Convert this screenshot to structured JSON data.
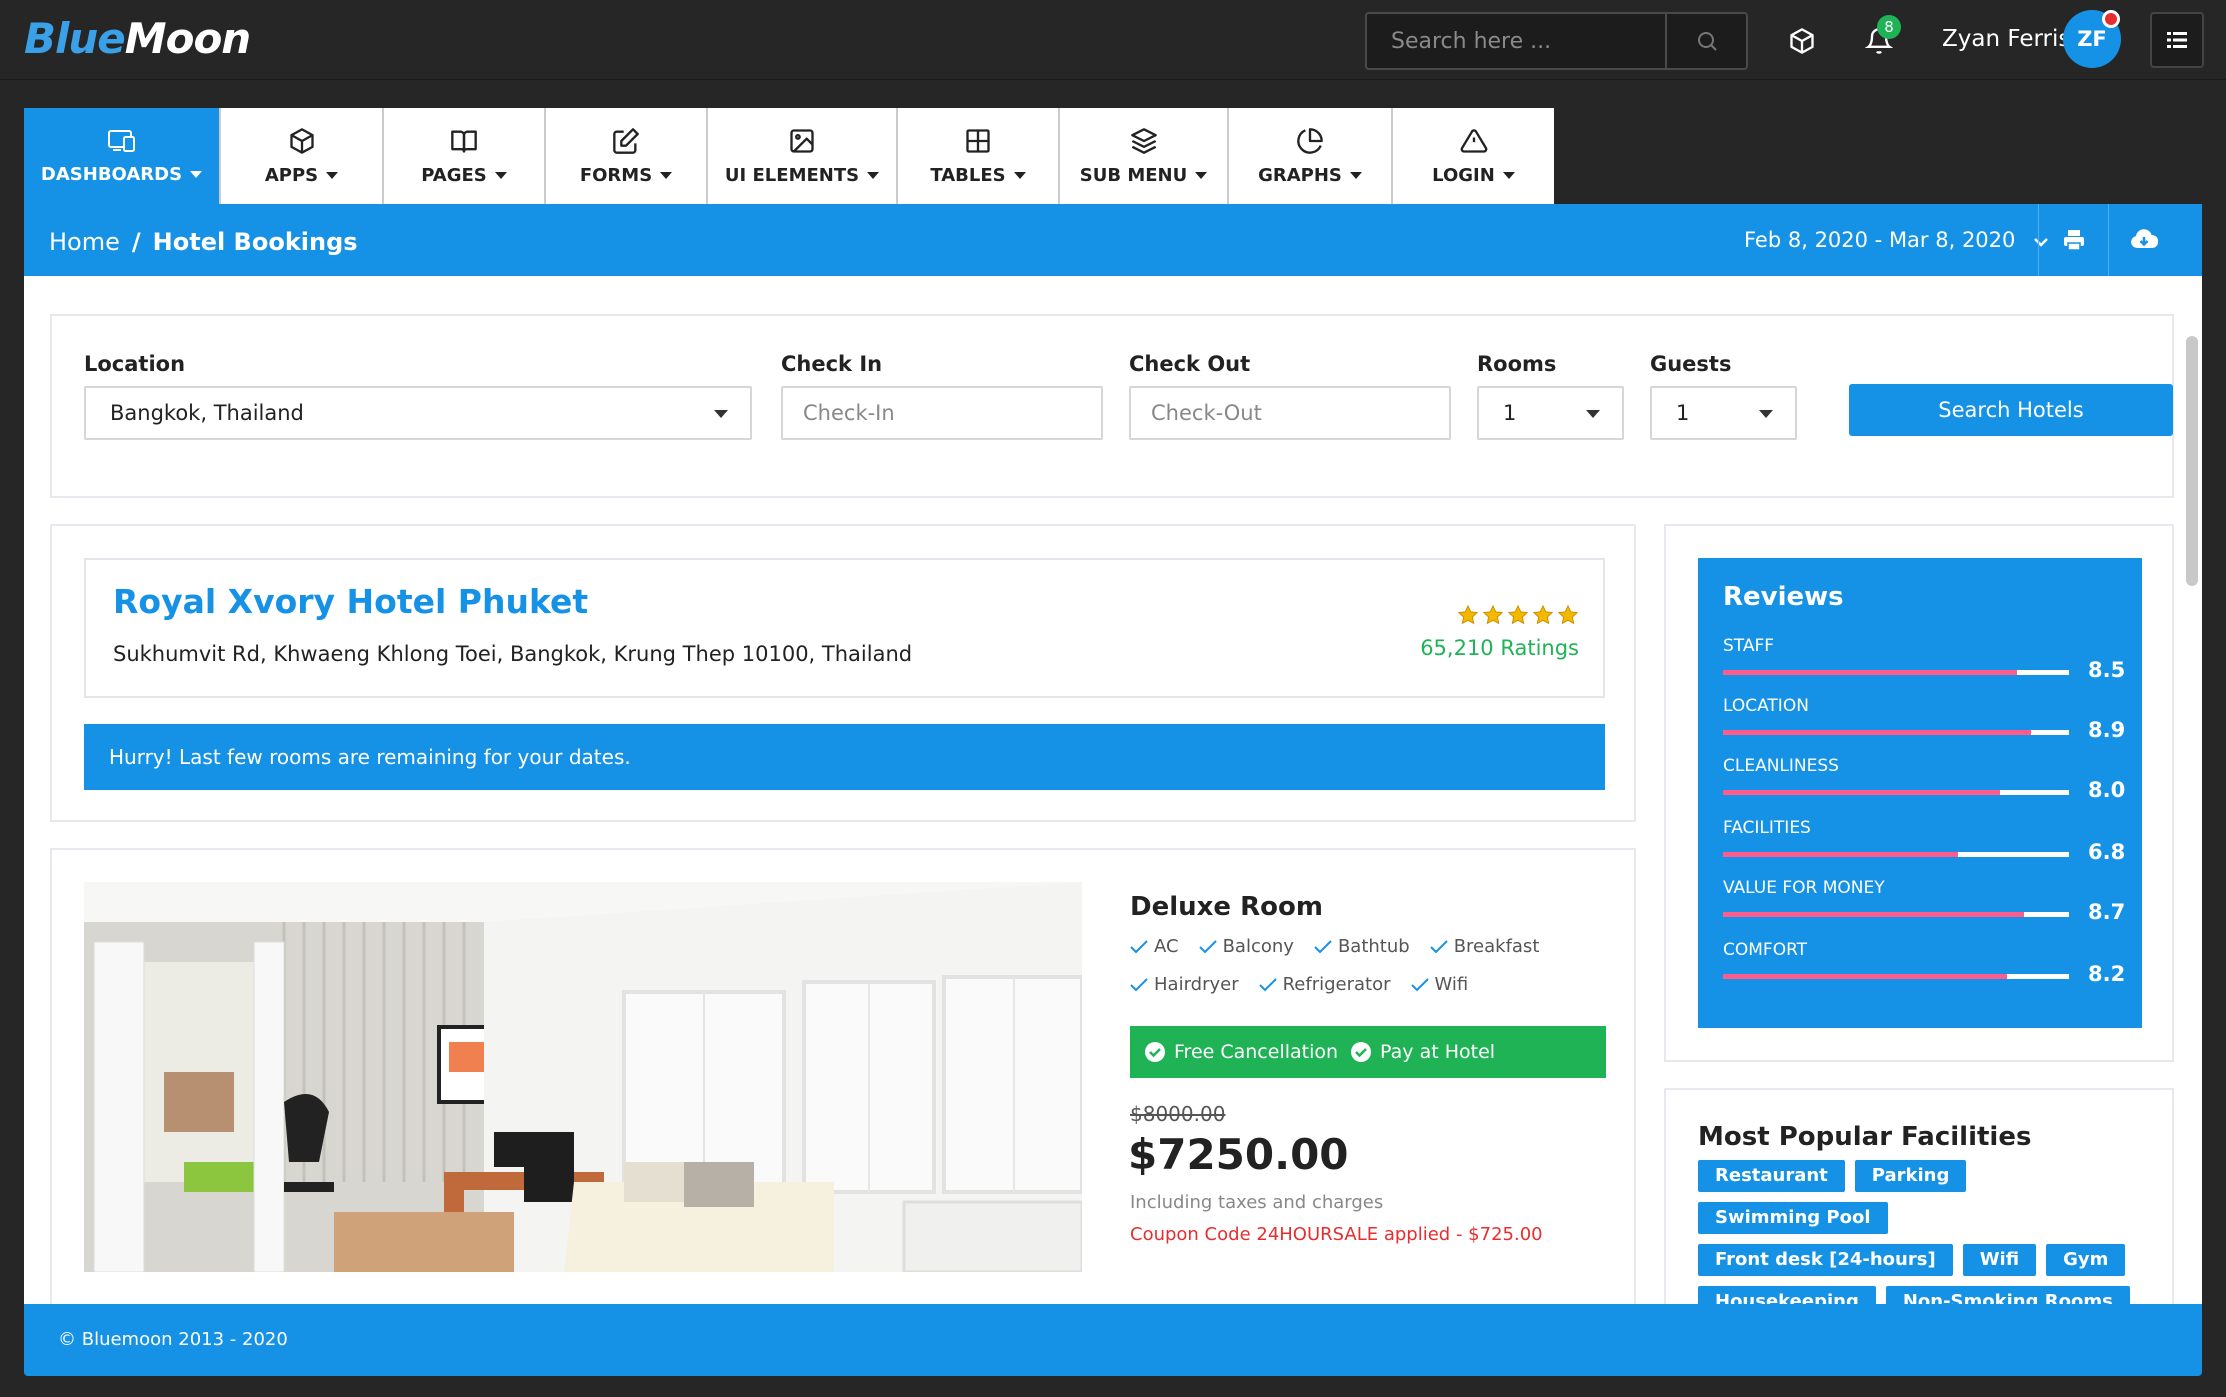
{
  "app": {
    "logo_blue": "Blue",
    "logo_white": "Moon"
  },
  "header": {
    "search_placeholder": "Search here ...",
    "notification_count": "8",
    "user_name": "Zyan Ferris",
    "user_initials": "ZF"
  },
  "nav": {
    "tabs": [
      {
        "label": "DASHBOARDS",
        "icon": "devices-icon",
        "active": true
      },
      {
        "label": "APPS",
        "icon": "box-icon",
        "active": false
      },
      {
        "label": "PAGES",
        "icon": "book-icon",
        "active": false
      },
      {
        "label": "FORMS",
        "icon": "edit-icon",
        "active": false
      },
      {
        "label": "UI ELEMENTS",
        "icon": "image-icon",
        "active": false
      },
      {
        "label": "TABLES",
        "icon": "grid-icon",
        "active": false
      },
      {
        "label": "SUB MENU",
        "icon": "layers-icon",
        "active": false
      },
      {
        "label": "GRAPHS",
        "icon": "pie-chart-icon",
        "active": false
      },
      {
        "label": "LOGIN",
        "icon": "alert-triangle-icon",
        "active": false
      }
    ]
  },
  "breadcrumb": {
    "home": "Home",
    "separator": "/",
    "current": "Hotel Bookings",
    "date_range": "Feb 8, 2020 - Mar 8, 2020"
  },
  "search_form": {
    "location_label": "Location",
    "location_value": "Bangkok, Thailand",
    "checkin_label": "Check In",
    "checkin_placeholder": "Check-In",
    "checkout_label": "Check Out",
    "checkout_placeholder": "Check-Out",
    "rooms_label": "Rooms",
    "rooms_value": "1",
    "guests_label": "Guests",
    "guests_value": "1",
    "submit_label": "Search Hotels"
  },
  "hotel": {
    "name": "Royal Xvory Hotel Phuket",
    "address": "Sukhumvit Rd, Khwaeng Khlong Toei, Bangkok, Krung Thep 10100, Thailand",
    "stars": 5,
    "ratings": "65,210 Ratings",
    "alert": "Hurry! Last few rooms are remaining for your dates."
  },
  "room": {
    "title": "Deluxe Room",
    "amenities_row1": [
      "AC",
      "Balcony",
      "Bathtub",
      "Breakfast"
    ],
    "amenities_row2": [
      "Hairdryer",
      "Refrigerator",
      "Wifi"
    ],
    "free_cancellation": "Free Cancellation",
    "pay_at_hotel": "Pay at Hotel",
    "old_price": "$8000.00",
    "price": "$7250.00",
    "taxes_note": "Including taxes and charges",
    "coupon": "Coupon Code 24HOURSALE applied - $725.00"
  },
  "reviews": {
    "title": "Reviews",
    "items": [
      {
        "label": "STAFF",
        "value": "8.5",
        "fraction": 0.85
      },
      {
        "label": "LOCATION",
        "value": "8.9",
        "fraction": 0.89
      },
      {
        "label": "CLEANLINESS",
        "value": "8.0",
        "fraction": 0.8
      },
      {
        "label": "FACILITIES",
        "value": "6.8",
        "fraction": 0.68
      },
      {
        "label": "VALUE FOR MONEY",
        "value": "8.7",
        "fraction": 0.87
      },
      {
        "label": "COMFORT",
        "value": "8.2",
        "fraction": 0.82
      }
    ]
  },
  "facilities": {
    "title": "Most Popular Facilities",
    "tags": [
      "Restaurant",
      "Parking",
      "Swimming Pool",
      "Front desk [24-hours]",
      "Wifi",
      "Gym",
      "Housekeeping",
      "Non-Smoking Rooms"
    ]
  },
  "footer": {
    "text": "© Bluemoon 2013 - 2020"
  },
  "colors": {
    "primary": "#1592e6",
    "success": "#1fb356",
    "danger": "#e62e2e",
    "review_bar": "#ff5b8c"
  }
}
